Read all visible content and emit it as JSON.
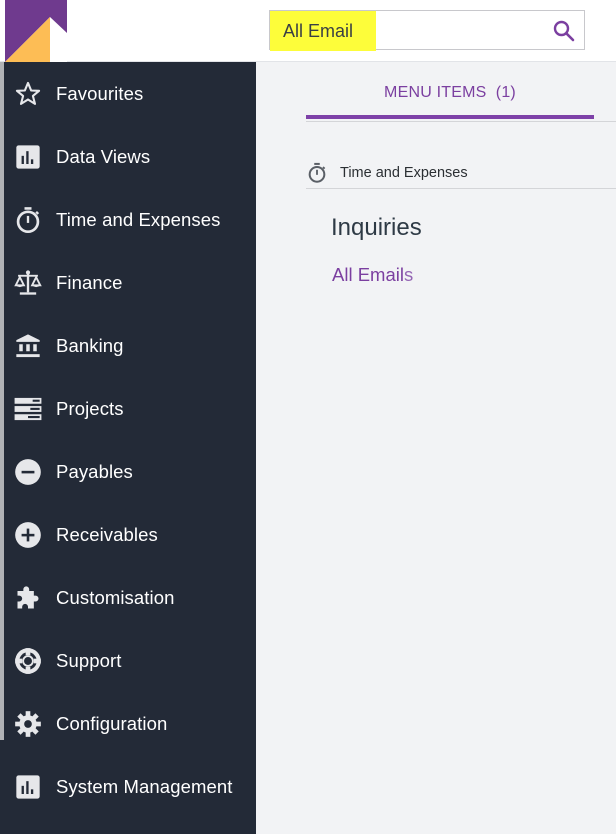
{
  "header": {
    "logo": "brand-logo",
    "search": {
      "value": "All Email",
      "icon": "search-icon"
    }
  },
  "sidebar": {
    "items": [
      {
        "label": "Favourites",
        "icon": "star-icon"
      },
      {
        "label": "Data Views",
        "icon": "bar-chart-icon"
      },
      {
        "label": "Time and Expenses",
        "icon": "stopwatch-icon"
      },
      {
        "label": "Finance",
        "icon": "scales-icon"
      },
      {
        "label": "Banking",
        "icon": "bank-icon"
      },
      {
        "label": "Projects",
        "icon": "server-stack-icon"
      },
      {
        "label": "Payables",
        "icon": "minus-circle-icon"
      },
      {
        "label": "Receivables",
        "icon": "plus-circle-icon"
      },
      {
        "label": "Customisation",
        "icon": "puzzle-icon"
      },
      {
        "label": "Support",
        "icon": "lifebuoy-icon"
      },
      {
        "label": "Configuration",
        "icon": "gear-icon"
      },
      {
        "label": "System Management",
        "icon": "bar-chart-icon"
      }
    ]
  },
  "main": {
    "tab": {
      "label": "MENU ITEMS",
      "count": "(1)"
    },
    "workspace": {
      "label": "Time and Expenses",
      "icon": "stopwatch-icon"
    },
    "section_title": "Inquiries",
    "result": {
      "match": "All Email",
      "rest": "s"
    }
  },
  "colors": {
    "accent": "#7e41a8",
    "sidebar_bg": "#232a37",
    "main_bg": "#f2f3f5",
    "highlight": "#fdfd3a",
    "logo_purple": "#6f3a8e",
    "logo_orange": "#fdbd55"
  }
}
